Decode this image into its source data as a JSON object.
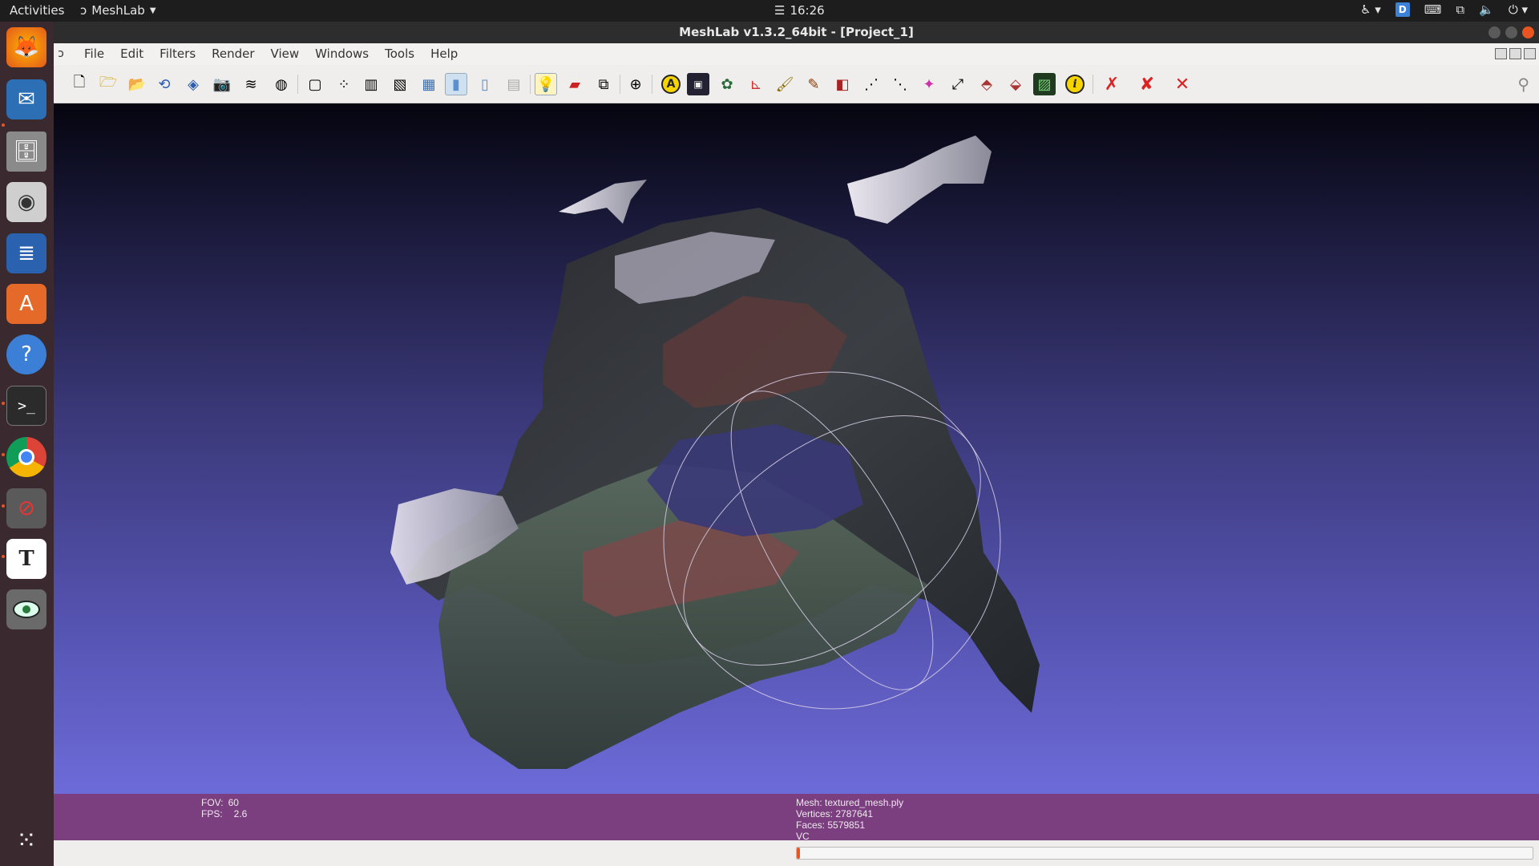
{
  "topbar": {
    "activities": "Activities",
    "app_name": "MeshLab",
    "clock": "16:26"
  },
  "window": {
    "title": "MeshLab v1.3.2_64bit - [Project_1]"
  },
  "menu": {
    "items": [
      "File",
      "Edit",
      "Filters",
      "Render",
      "View",
      "Windows",
      "Tools",
      "Help"
    ]
  },
  "toolbar": {
    "icons": [
      "new-project-icon",
      "open-project-icon",
      "open-mesh-icon",
      "reload-icon",
      "save-icon",
      "snapshot-icon",
      "layers-icon",
      "globe-icon",
      "bounding-box-icon",
      "points-icon",
      "wireframe-icon",
      "hidden-lines-icon",
      "flat-lines-icon",
      "flat-shading-icon",
      "smooth-shading-icon",
      "texture-icon",
      "light-icon",
      "backface-icon",
      "fancy-lighting-icon",
      "trackball-icon",
      "annotation-icon",
      "raster-icon",
      "color-wheel-icon",
      "axis-icon",
      "paint-icon",
      "brush-icon",
      "align-icon",
      "select-faces-icon",
      "select-vertices-icon",
      "pickpoints-icon",
      "fit-icon",
      "measure-icon",
      "mask-icon",
      "raster-layer-icon",
      "info-icon",
      "delete-faces-icon",
      "delete-vertices-icon",
      "delete-both-icon"
    ]
  },
  "status": {
    "fov_label": "FOV:",
    "fov_value": "60",
    "fps_label": "FPS:",
    "fps_value": "2.6",
    "mesh": "Mesh: textured_mesh.ply",
    "vertices": "Vertices: 2787641",
    "faces": "Faces: 5579851",
    "mode": "VC"
  },
  "progress": {
    "fraction": 0.004
  },
  "colors": {
    "accent": "#e95420",
    "info_bar": "#7b3f7f"
  }
}
